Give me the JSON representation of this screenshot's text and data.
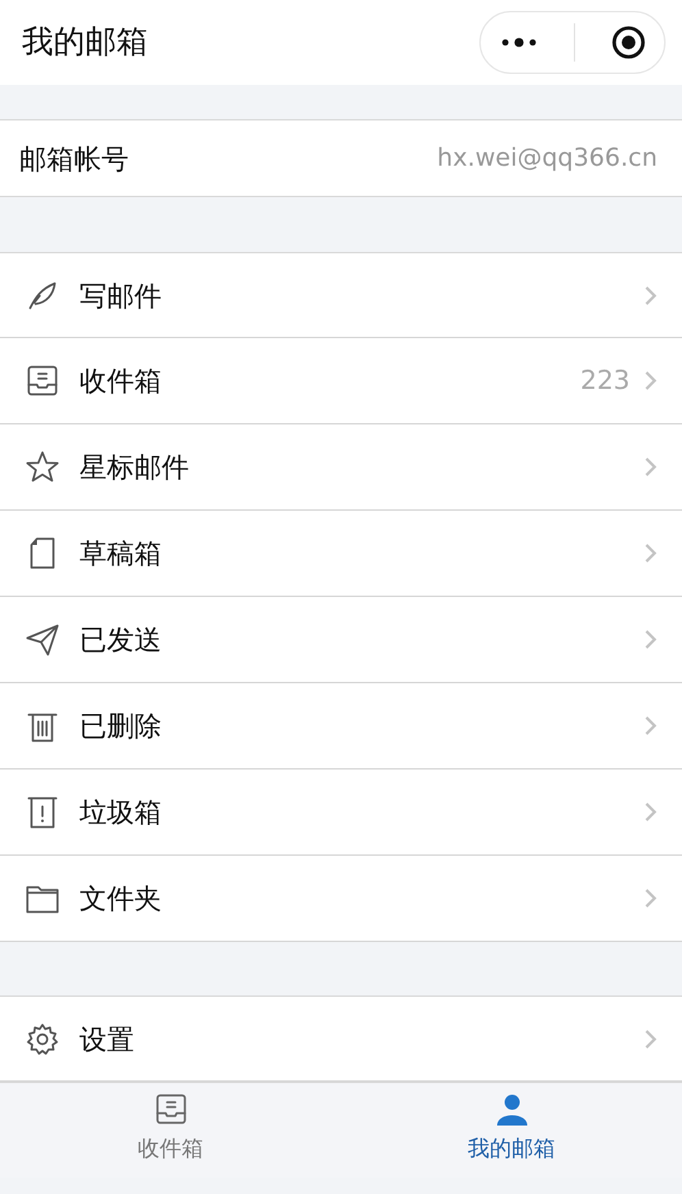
{
  "header": {
    "title": "我的邮箱"
  },
  "account": {
    "label": "邮箱帐号",
    "value": "hx.wei@qq366.cn"
  },
  "folders": [
    {
      "kind": "compose",
      "label": "写邮件"
    },
    {
      "kind": "inbox",
      "label": "收件箱",
      "count": "223"
    },
    {
      "kind": "star",
      "label": "星标邮件"
    },
    {
      "kind": "draft",
      "label": "草稿箱"
    },
    {
      "kind": "sent",
      "label": "已发送"
    },
    {
      "kind": "trash",
      "label": "已删除"
    },
    {
      "kind": "spam",
      "label": "垃圾箱"
    },
    {
      "kind": "folder",
      "label": "文件夹"
    }
  ],
  "settings": [
    {
      "kind": "gear",
      "label": "设置"
    }
  ],
  "tab_bar": [
    {
      "kind": "inbox",
      "label": "收件箱",
      "selected": false
    },
    {
      "kind": "person",
      "label": "我的邮箱",
      "selected": true
    }
  ]
}
